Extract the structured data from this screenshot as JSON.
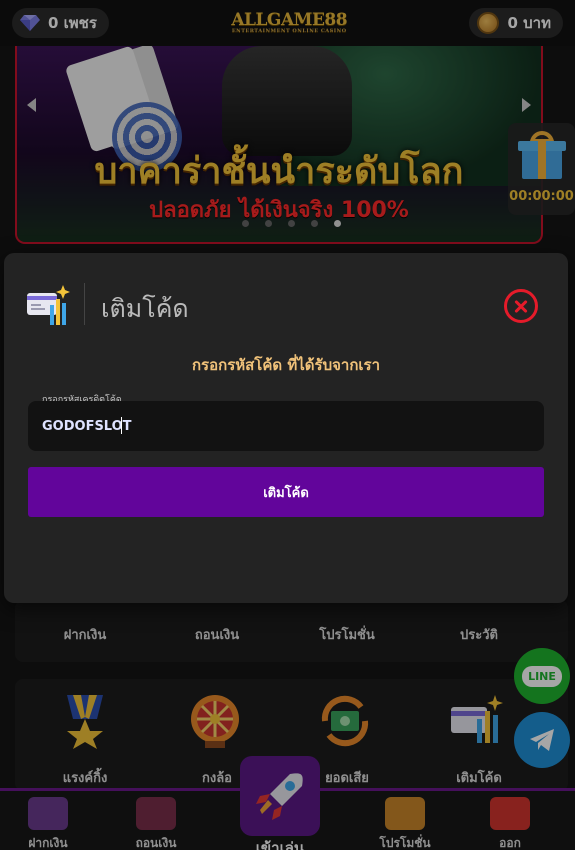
{
  "topbar": {
    "diamond_text": "0 เพชร",
    "logo_text": "ALLGAME88",
    "logo_tagline": "ENTERTAINMENT ONLINE CASINO",
    "credit_text": "0 บาท",
    "diamond_icon": "diamond-icon",
    "coin_icon": "coin-icon"
  },
  "banner": {
    "title": "บาคาร่าชั้นนำระดับโลก",
    "subtitle": "ปลอดภัย ได้เงินจริง 100%"
  },
  "gift": {
    "timer": "00:00:00",
    "icon": "gift-icon"
  },
  "menu_row1": [
    {
      "label": "ฝากเงิน"
    },
    {
      "label": "ถอนเงิน"
    },
    {
      "label": "โปรโมชั่น"
    },
    {
      "label": "ประวัติ"
    }
  ],
  "menu_row2": [
    {
      "label": "แรงค์กิ้ง",
      "icon": "medal-icon"
    },
    {
      "label": "กงล้อ",
      "icon": "wheel-icon"
    },
    {
      "label": "ยอดเสีย",
      "icon": "cashback-icon"
    },
    {
      "label": "เติมโค้ด",
      "icon": "code-card-icon"
    }
  ],
  "social": {
    "line_label": "LINE",
    "telegram_icon": "telegram-icon"
  },
  "bottom_nav": {
    "deposit": "ฝากเงิน",
    "withdraw": "ถอนเงิน",
    "play": "เข้าเล่น",
    "promo": "โปรโมชั่น",
    "logout": "ออก"
  },
  "modal": {
    "title": "เติมโค้ด",
    "prompt": "กรอกรหัสโค้ด ที่ได้รับจากเรา",
    "field_label": "กรอกรหัสเครดิตโค้ด",
    "input_value": "GODOFSLOT",
    "submit_label": "เติมโค้ด"
  },
  "colors": {
    "accent_purple": "#62059b",
    "close_red": "#e51b2a",
    "prompt_gold": "#f0c27a"
  }
}
